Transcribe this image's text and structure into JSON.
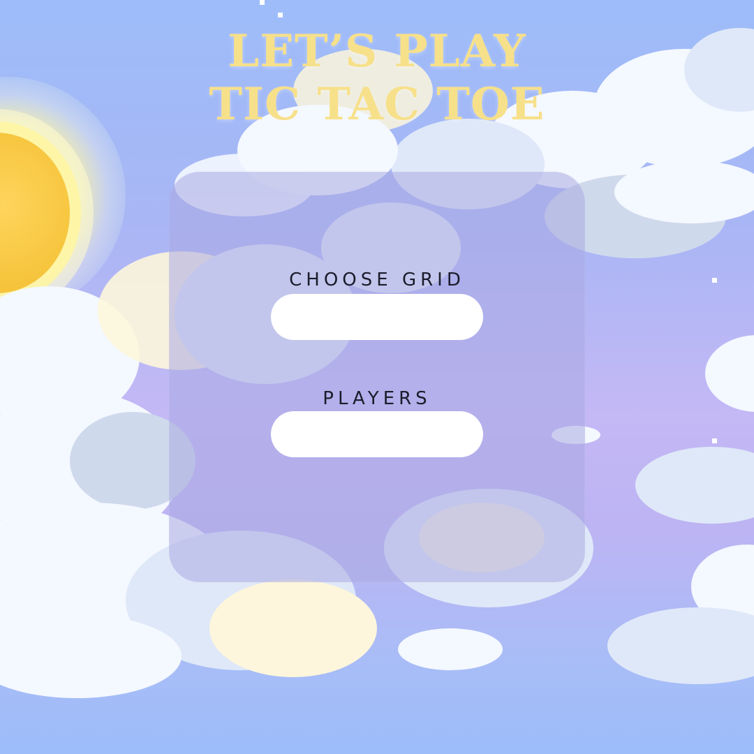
{
  "title": {
    "line1": "LET’S PLAY",
    "line2": "TIC TAC TOE"
  },
  "form": {
    "grid_label": "CHOOSE GRID",
    "grid_value": "",
    "players_label": "PLAYERS",
    "players_value": ""
  },
  "colors": {
    "title": "#f7e08a",
    "sky_top": "#9dbcf9",
    "sky_mid": "#c4b8f5",
    "panel": "#aaaae1",
    "pill": "#ffffff",
    "label": "#1b1c2a"
  }
}
